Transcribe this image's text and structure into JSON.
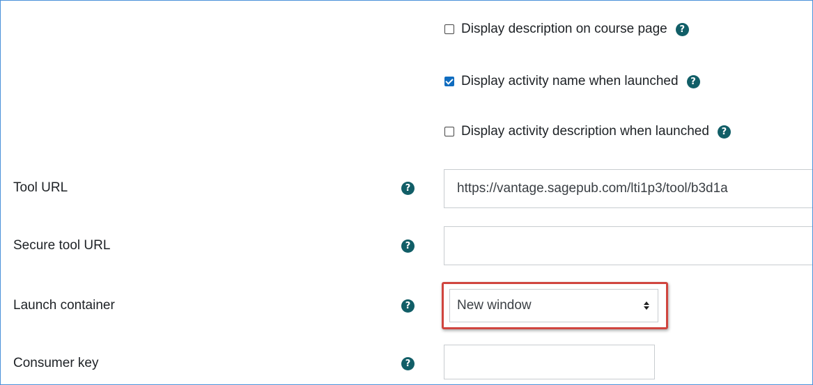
{
  "checkboxes": [
    {
      "label": "Display description on course page",
      "checked": false
    },
    {
      "label": "Display activity name when launched",
      "checked": true
    },
    {
      "label": "Display activity description when launched",
      "checked": false
    }
  ],
  "fields": {
    "tool_url": {
      "label": "Tool URL",
      "value": "https://vantage.sagepub.com/lti1p3/tool/b3d1a"
    },
    "secure_tool_url": {
      "label": "Secure tool URL",
      "value": ""
    },
    "launch_container": {
      "label": "Launch container",
      "value": "New window"
    },
    "consumer_key": {
      "label": "Consumer key",
      "value": ""
    }
  },
  "icons": {
    "help": "question-circle-icon",
    "help_glyph": "?"
  },
  "colors": {
    "help_icon": "#115e67",
    "checkbox_checked": "#0f6cbf",
    "highlight_border": "#d0453f",
    "frame_border": "#4a90d9"
  }
}
